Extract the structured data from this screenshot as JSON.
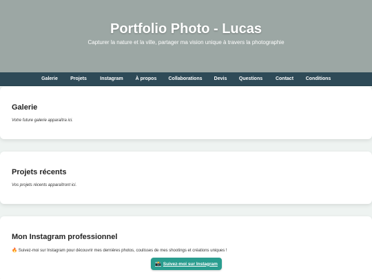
{
  "header": {
    "title": "Portfolio Photo - Lucas",
    "subtitle": "Capturer la nature et la ville, partager ma vision unique à travers la photographie"
  },
  "nav": {
    "items": [
      {
        "label": "Galerie"
      },
      {
        "label": "Projets"
      },
      {
        "label": "Instagram"
      },
      {
        "label": "À propos"
      },
      {
        "label": "Collaborations"
      },
      {
        "label": "Devis"
      },
      {
        "label": "Questions"
      },
      {
        "label": "Contact"
      },
      {
        "label": "Conditions"
      }
    ]
  },
  "sections": {
    "gallery": {
      "title": "Galerie",
      "note": "Votre future galerie apparaîtra ici."
    },
    "projects": {
      "title": "Projets récents",
      "note": "Vos projets récents apparaîtront ici."
    },
    "instagram": {
      "title": "Mon Instagram professionnel",
      "emoji": "🔥",
      "text": "Suivez-moi sur Instagram pour découvrir mes dernières photos, coulisses de mes shootings et créations uniques !",
      "button_icon": "📸",
      "button_label": "Suivez-moi sur Instagram"
    }
  },
  "colors": {
    "hero": "#9ca7a4",
    "nav": "#2e4a57",
    "button": "#2a9d8f",
    "background": "#eef3f1"
  }
}
